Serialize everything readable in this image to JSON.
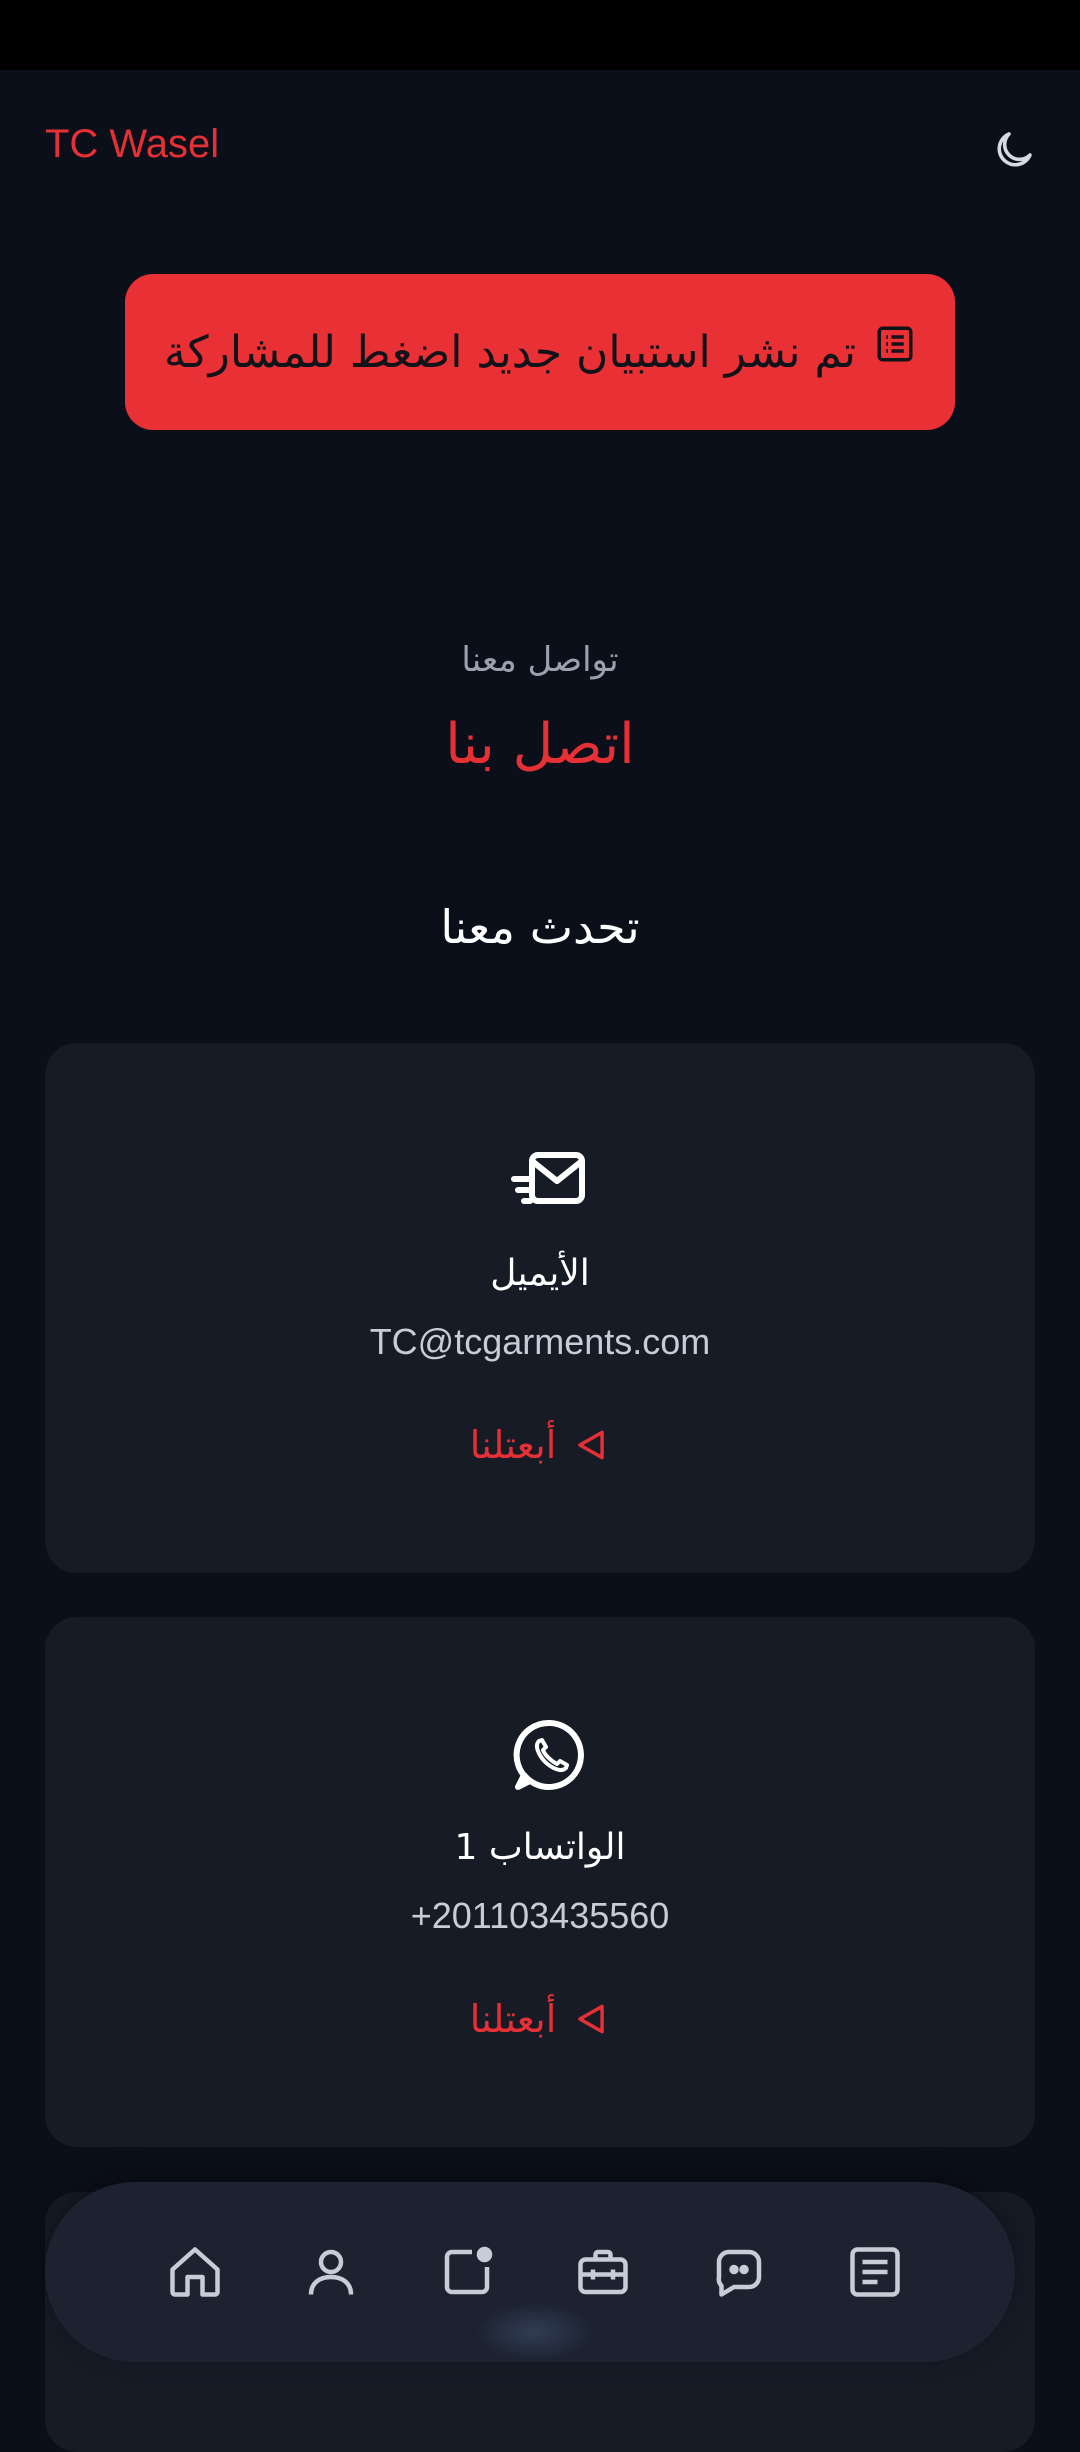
{
  "app": {
    "brand": "TC Wasel"
  },
  "banner": {
    "text": "تم نشر استبيان جديد اضغط للمشاركة",
    "icon": "list-icon"
  },
  "header": {
    "eyebrow": "تواصل معنا",
    "title": "اتصل بنا",
    "section_title": "تحدث معنا"
  },
  "cards": [
    {
      "icon": "email-icon",
      "label": "الأيميل",
      "value": "TC@tcgarments.com",
      "action": "أبعتلنا"
    },
    {
      "icon": "whatsapp-icon",
      "label": "الواتساب 1",
      "value": "+201103435560",
      "action": "أبعتلنا"
    }
  ],
  "nav": [
    "home-icon",
    "profile-icon",
    "notes-icon",
    "jobs-icon",
    "chat-icon",
    "articles-icon"
  ],
  "colors": {
    "accent": "#e53035",
    "background": "#0b0f19",
    "card": "#161b26"
  }
}
